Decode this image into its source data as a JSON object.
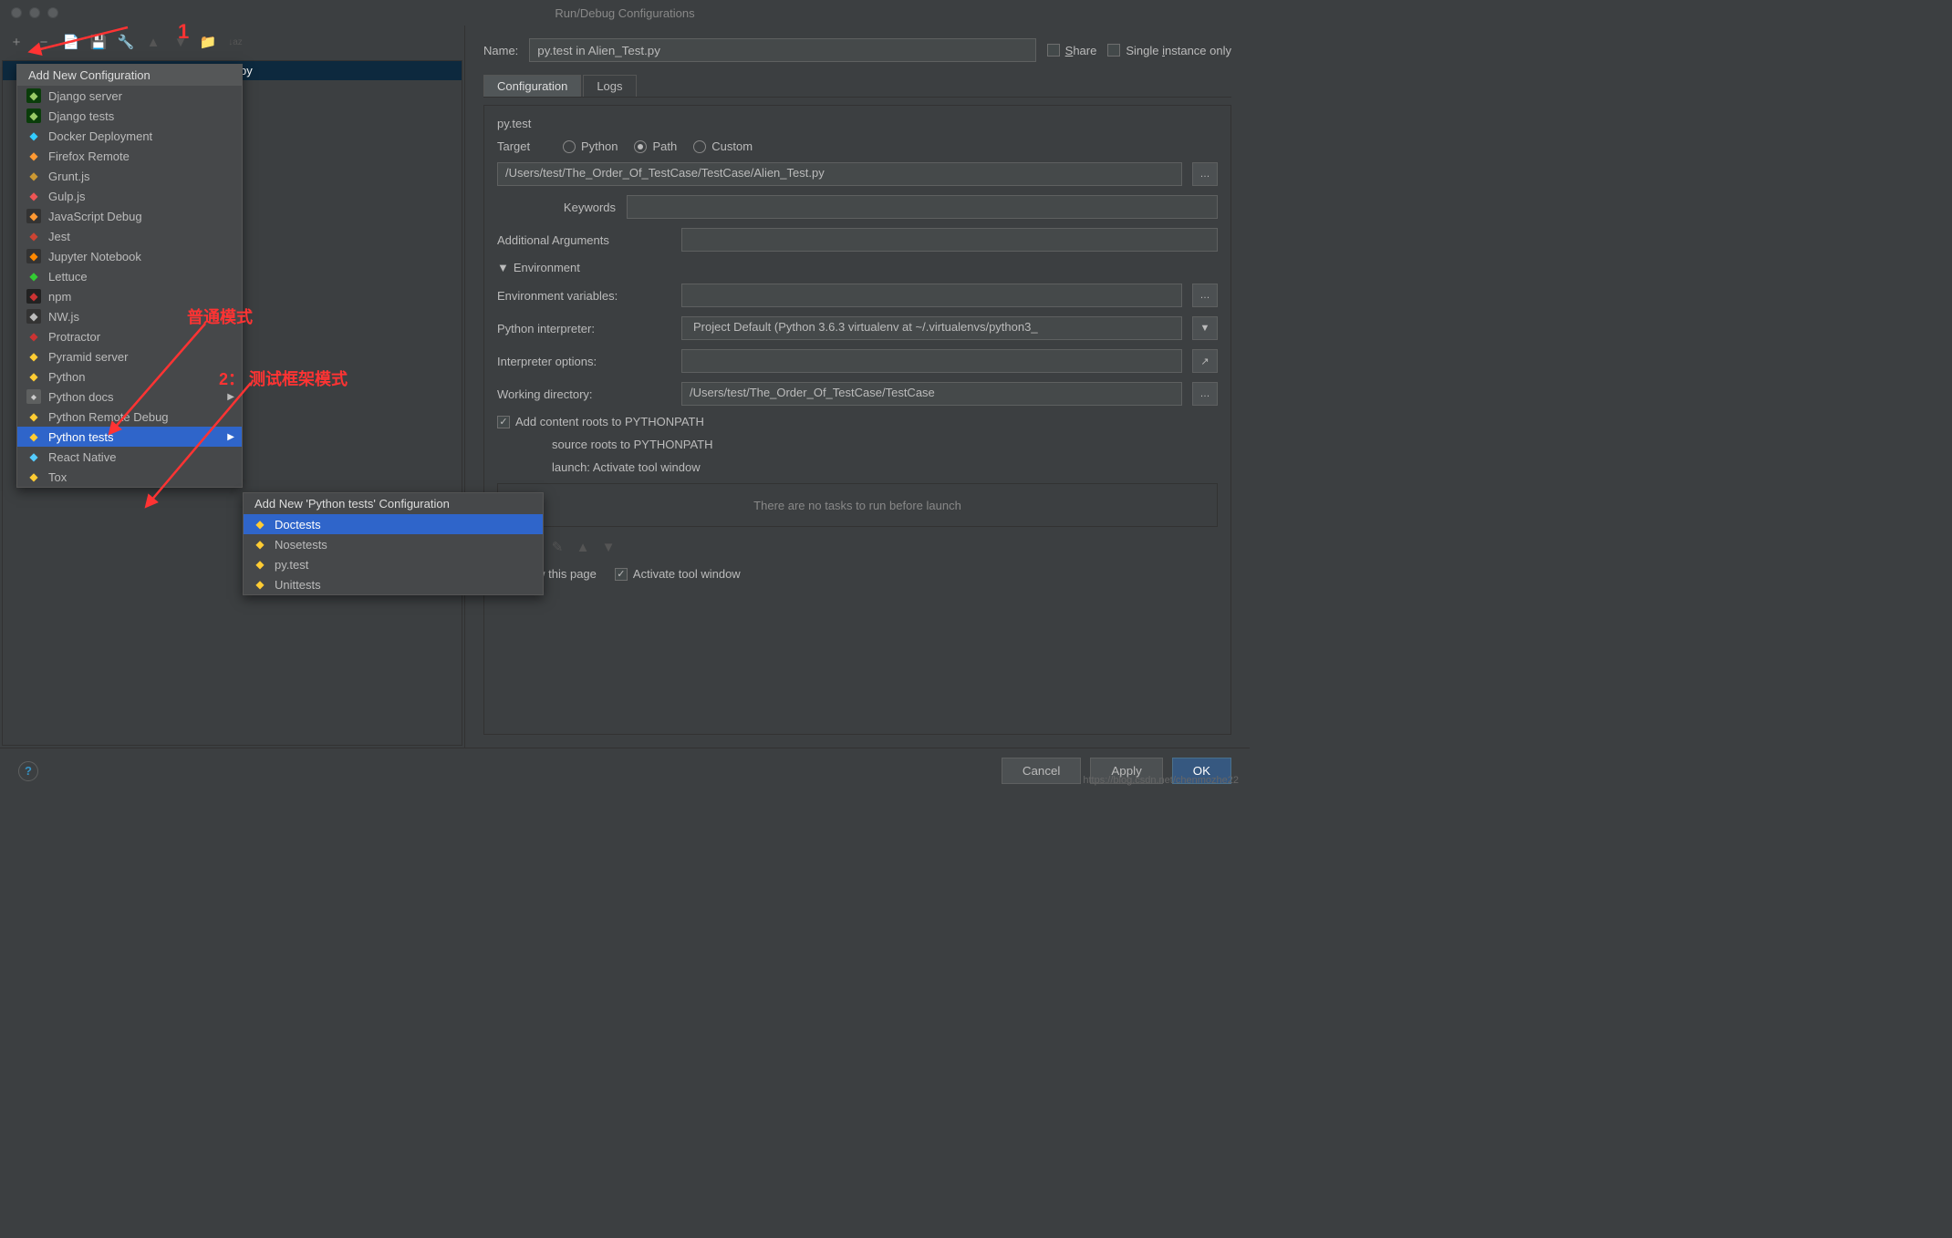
{
  "window_title": "Run/Debug Configurations",
  "toolbar": {
    "plus": "+",
    "minus": "−"
  },
  "tree_selected": "py",
  "name_label": "Name:",
  "name_value": "py.test in Alien_Test.py",
  "share_label": "Share",
  "single_instance_label": "Single instance only",
  "tabs": {
    "configuration": "Configuration",
    "logs": "Logs"
  },
  "section": "py.test",
  "target_label": "Target",
  "radios": {
    "python": "Python",
    "path": "Path",
    "custom": "Custom"
  },
  "path_value": "/Users/test/The_Order_Of_TestCase/TestCase/Alien_Test.py",
  "keywords_label": "Keywords",
  "addargs_label": "Additional Arguments",
  "env_header": "Environment",
  "envvars_label": "Environment variables:",
  "interp_label": "Python interpreter:",
  "interp_value": "Project Default (Python 3.6.3 virtualenv at ~/.virtualenvs/python3_",
  "interp_opts_label": "Interpreter options:",
  "workdir_label": "Working directory:",
  "workdir_value": "/Users/test/The_Order_Of_TestCase/TestCase",
  "chk_content_roots": "Add content roots to PYTHONPATH",
  "chk_source_roots": "source roots to PYTHONPATH",
  "before_header": "launch: Activate tool window",
  "before_empty": "There are no tasks to run before launch",
  "show_page": "Show this page",
  "activate_tool": "Activate tool window",
  "buttons": {
    "cancel": "Cancel",
    "apply": "Apply",
    "ok": "OK"
  },
  "menu1_header": "Add New Configuration",
  "menu1_items": [
    {
      "icon": "i-dj",
      "label": "Django server"
    },
    {
      "icon": "i-dj",
      "label": "Django tests"
    },
    {
      "icon": "i-dk",
      "label": "Docker Deployment"
    },
    {
      "icon": "i-ff",
      "label": "Firefox Remote"
    },
    {
      "icon": "i-gr",
      "label": "Grunt.js"
    },
    {
      "icon": "i-gu",
      "label": "Gulp.js"
    },
    {
      "icon": "i-js",
      "label": "JavaScript Debug"
    },
    {
      "icon": "i-je",
      "label": "Jest"
    },
    {
      "icon": "i-jp",
      "label": "Jupyter Notebook"
    },
    {
      "icon": "i-le",
      "label": "Lettuce"
    },
    {
      "icon": "i-np",
      "label": "npm"
    },
    {
      "icon": "i-nw",
      "label": "NW.js"
    },
    {
      "icon": "i-pr",
      "label": "Protractor"
    },
    {
      "icon": "i-py",
      "label": "Pyramid server"
    },
    {
      "icon": "i-py",
      "label": "Python"
    },
    {
      "icon": "i-rst",
      "label": "Python docs",
      "sub": true
    },
    {
      "icon": "i-py",
      "label": "Python Remote Debug"
    },
    {
      "icon": "i-py",
      "label": "Python tests",
      "sub": true,
      "hl": true
    },
    {
      "icon": "i-rn",
      "label": "React Native"
    },
    {
      "icon": "i-tx",
      "label": "Tox"
    }
  ],
  "menu2_header": "Add New 'Python tests' Configuration",
  "menu2_items": [
    {
      "icon": "i-py",
      "label": "Doctests",
      "hl": true
    },
    {
      "icon": "i-py",
      "label": "Nosetests"
    },
    {
      "icon": "i-py",
      "label": "py.test"
    },
    {
      "icon": "i-py",
      "label": "Unittests"
    }
  ],
  "anno1": "1",
  "anno2": "普通模式",
  "anno3": "2：   测试框架模式",
  "watermark": "https://blog.csdn.net/chenmozhe22"
}
